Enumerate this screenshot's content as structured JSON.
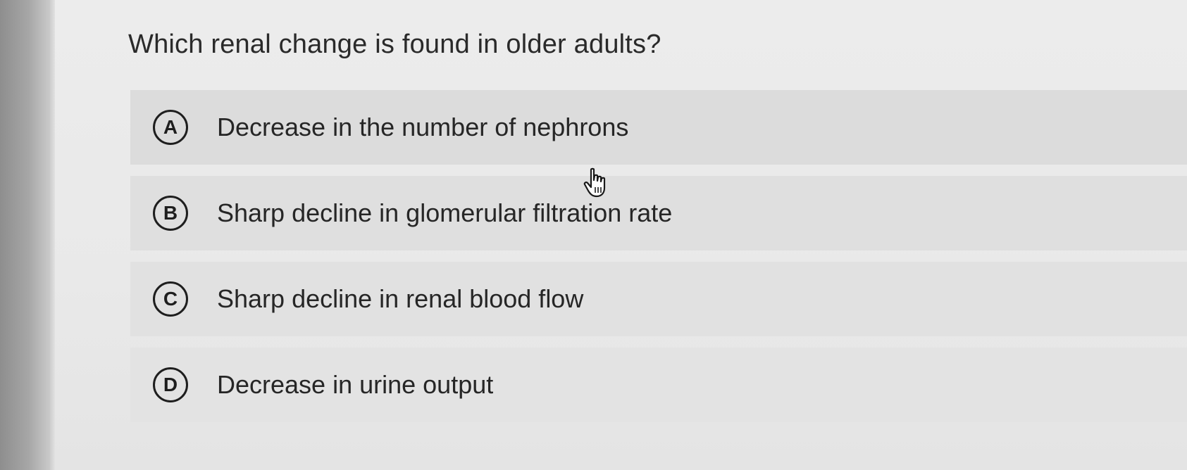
{
  "question": "Which renal change is found in older adults?",
  "choices": [
    {
      "letter": "A",
      "text": "Decrease in the number of nephrons"
    },
    {
      "letter": "B",
      "text": "Sharp decline in glomerular filtration rate"
    },
    {
      "letter": "C",
      "text": "Sharp decline in renal blood flow"
    },
    {
      "letter": "D",
      "text": "Decrease in urine output"
    }
  ],
  "cursor": {
    "icon": "hand-pointer-icon"
  },
  "colors": {
    "text": "#262626",
    "option_bg": "#e0e0e0",
    "page_bg": "#ececec"
  }
}
